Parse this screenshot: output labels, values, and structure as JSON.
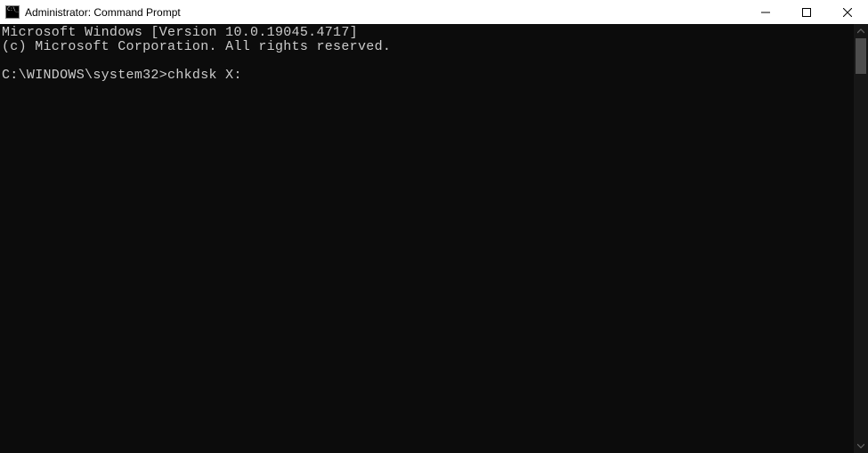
{
  "window": {
    "title": "Administrator: Command Prompt"
  },
  "terminal": {
    "line1": "Microsoft Windows [Version 10.0.19045.4717]",
    "line2": "(c) Microsoft Corporation. All rights reserved.",
    "blank": "",
    "prompt": "C:\\WINDOWS\\system32>",
    "command": "chkdsk X:"
  }
}
